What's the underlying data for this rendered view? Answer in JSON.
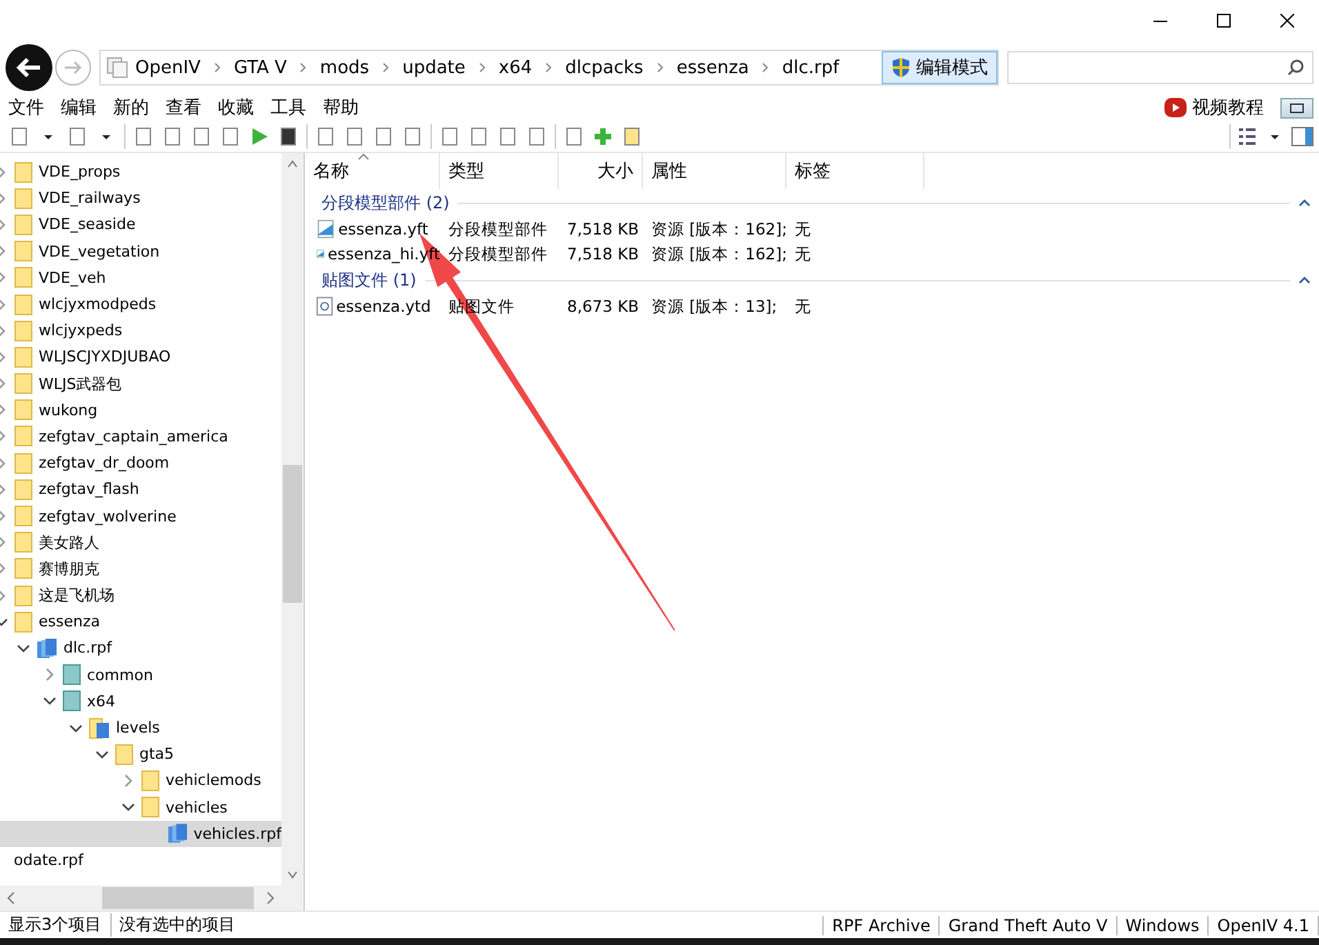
{
  "breadcrumb": [
    "OpenIV",
    "GTA V",
    "mods",
    "update",
    "x64",
    "dlcpacks",
    "essenza",
    "dlc.rpf"
  ],
  "edit_mode_button": "编辑模式",
  "menu": [
    "文件",
    "编辑",
    "新的",
    "查看",
    "收藏",
    "工具",
    "帮助"
  ],
  "video_tutorial": "视频教程",
  "tree": {
    "items": [
      {
        "label": "VDE_props",
        "kind": "folder",
        "expanded": false,
        "selected": false
      },
      {
        "label": "VDE_railways",
        "kind": "folder",
        "expanded": false,
        "selected": false
      },
      {
        "label": "VDE_seaside",
        "kind": "folder",
        "expanded": false,
        "selected": false
      },
      {
        "label": "VDE_vegetation",
        "kind": "folder",
        "expanded": false,
        "selected": false
      },
      {
        "label": "VDE_veh",
        "kind": "folder",
        "expanded": false,
        "selected": false
      },
      {
        "label": "wlcjyxmodpeds",
        "kind": "folder",
        "expanded": false,
        "selected": false
      },
      {
        "label": "wlcjyxpeds",
        "kind": "folder",
        "expanded": false,
        "selected": false
      },
      {
        "label": "WLJSCJYXDJUBAO",
        "kind": "folder",
        "expanded": false,
        "selected": false
      },
      {
        "label": "WLJS武器包",
        "kind": "folder",
        "expanded": false,
        "selected": false
      },
      {
        "label": "wukong",
        "kind": "folder",
        "expanded": false,
        "selected": false
      },
      {
        "label": "zefgtav_captain_america",
        "kind": "folder",
        "expanded": false,
        "selected": false
      },
      {
        "label": "zefgtav_dr_doom",
        "kind": "folder",
        "expanded": false,
        "selected": false
      },
      {
        "label": "zefgtav_flash",
        "kind": "folder",
        "expanded": false,
        "selected": false
      },
      {
        "label": "zefgtav_wolverine",
        "kind": "folder",
        "expanded": false,
        "selected": false
      },
      {
        "label": "美女路人",
        "kind": "folder",
        "expanded": false,
        "selected": false
      },
      {
        "label": "赛博朋克",
        "kind": "folder",
        "expanded": false,
        "selected": false
      },
      {
        "label": "这是飞机场",
        "kind": "folder",
        "expanded": false,
        "selected": false
      },
      {
        "label": "essenza",
        "kind": "folder",
        "expanded": true,
        "selected": false,
        "children": [
          {
            "label": "dlc.rpf",
            "kind": "archive",
            "expanded": true,
            "selected": false,
            "children": [
              {
                "label": "common",
                "kind": "teal",
                "expanded": false,
                "selected": false
              },
              {
                "label": "x64",
                "kind": "teal",
                "expanded": true,
                "selected": false,
                "children": [
                  {
                    "label": "levels",
                    "kind": "levels",
                    "expanded": true,
                    "selected": false,
                    "children": [
                      {
                        "label": "gta5",
                        "kind": "folder",
                        "expanded": true,
                        "selected": false,
                        "children": [
                          {
                            "label": "vehiclemods",
                            "kind": "folder",
                            "expanded": false,
                            "selected": false
                          },
                          {
                            "label": "vehicles",
                            "kind": "folder",
                            "expanded": true,
                            "selected": false,
                            "children": [
                              {
                                "label": "vehicles.rpf",
                                "kind": "archive",
                                "selected": true
                              }
                            ]
                          }
                        ]
                      }
                    ]
                  }
                ]
              }
            ]
          }
        ]
      },
      {
        "label": "odate.rpf",
        "kind": "none",
        "selected": false
      }
    ]
  },
  "columns": [
    {
      "label": "名称",
      "sorted": true
    },
    {
      "label": "类型",
      "sorted": false
    },
    {
      "label": "大小",
      "sorted": false
    },
    {
      "label": "属性",
      "sorted": false
    },
    {
      "label": "标签",
      "sorted": false
    }
  ],
  "groups": [
    {
      "label": "分段模型部件 (2)",
      "expanded": true,
      "rows": [
        {
          "kind": "model",
          "name": "essenza.yft",
          "type": "分段模型部件",
          "size": "7,518 KB",
          "attributes": "资源 [版本：162];",
          "tag": "无"
        },
        {
          "kind": "model",
          "name": "essenza_hi.yft",
          "type": "分段模型部件",
          "size": "7,518 KB",
          "attributes": "资源 [版本：162];",
          "tag": "无"
        }
      ]
    },
    {
      "label": "贴图文件 (1)",
      "expanded": true,
      "rows": [
        {
          "kind": "texture",
          "name": "essenza.ytd",
          "type": "贴图文件",
          "size": "8,673 KB",
          "attributes": "资源 [版本：13];",
          "tag": "无"
        }
      ]
    }
  ],
  "status_bar": {
    "left": [
      "显示3个项目",
      "没有选中的项目"
    ],
    "right": [
      "RPF Archive",
      "Grand Theft Auto V",
      "Windows",
      "OpenIV 4.1"
    ]
  }
}
